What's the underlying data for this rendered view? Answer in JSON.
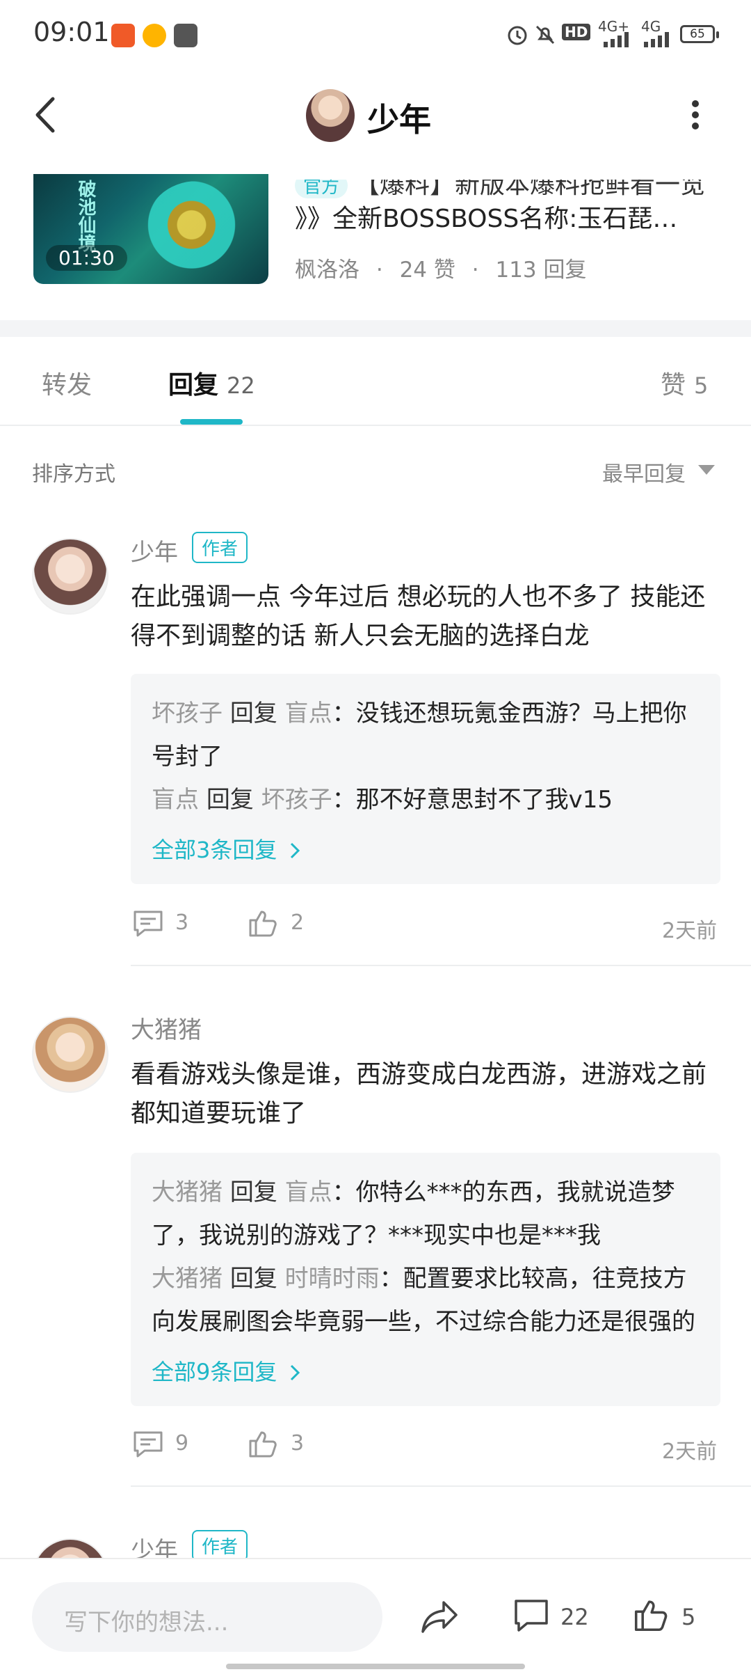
{
  "status_bar": {
    "time": "09:01",
    "network_label": "HD",
    "signal_a": "4G+",
    "signal_b": "4G",
    "battery": "65"
  },
  "header": {
    "title": "少年",
    "back_icon": "chevron-left-icon",
    "more_icon": "vertical-dots-icon"
  },
  "post": {
    "video_duration": "01:30",
    "top_line": "【爆料】新版本爆料抢鲜看一览",
    "title": "》》全新BOSSBOSS名称:玉石琵…",
    "author": "枫洛洛",
    "likes": "24 赞",
    "replies": "113 回复",
    "sep": "·"
  },
  "tabs": {
    "forward": "转发",
    "reply": "回复",
    "reply_count": "22",
    "like": "赞",
    "like_count": "5"
  },
  "sort": {
    "label": "排序方式",
    "value": "最早回复"
  },
  "comments": [
    {
      "name": "少年",
      "badge": "作者",
      "text": "在此强调一点 今年过后 想必玩的人也不多了 技能还得不到调整的话 新人只会无脑的选择白龙",
      "replies": [
        {
          "from": "坏孩子",
          "kw": "回复",
          "to": "盲点",
          "text": "：没钱还想玩氪金西游？马上把你号封了"
        },
        {
          "from": "盲点",
          "kw": "回复",
          "to": "坏孩子",
          "text": "：那不好意思封不了我v15"
        }
      ],
      "all_replies": "全部3条回复",
      "comment_count": "3",
      "like_count": "2",
      "time": "2天前"
    },
    {
      "name": "大猪猪",
      "text": "看看游戏头像是谁，西游变成白龙西游，进游戏之前都知道要玩谁了",
      "replies": [
        {
          "from": "大猪猪",
          "kw": "回复",
          "to": "盲点",
          "text": "：你特么***的东西，我就说造梦了，我说别的游戏了？***现实中也是***我"
        },
        {
          "from": "大猪猪",
          "kw": "回复",
          "to": "时晴时雨",
          "text": "：配置要求比较高，往竞技方向发展刷图会毕竟弱一些，不过综合能力还是很强的"
        }
      ],
      "all_replies": "全部9条回复",
      "comment_count": "9",
      "like_count": "3",
      "time": "2天前"
    },
    {
      "name": "少年",
      "badge": "作者"
    }
  ],
  "bottom_bar": {
    "placeholder": "写下你的想法...",
    "comment_count": "22",
    "like_count": "5"
  },
  "colors": {
    "accent": "#1fb7c7",
    "muted": "#999999"
  }
}
